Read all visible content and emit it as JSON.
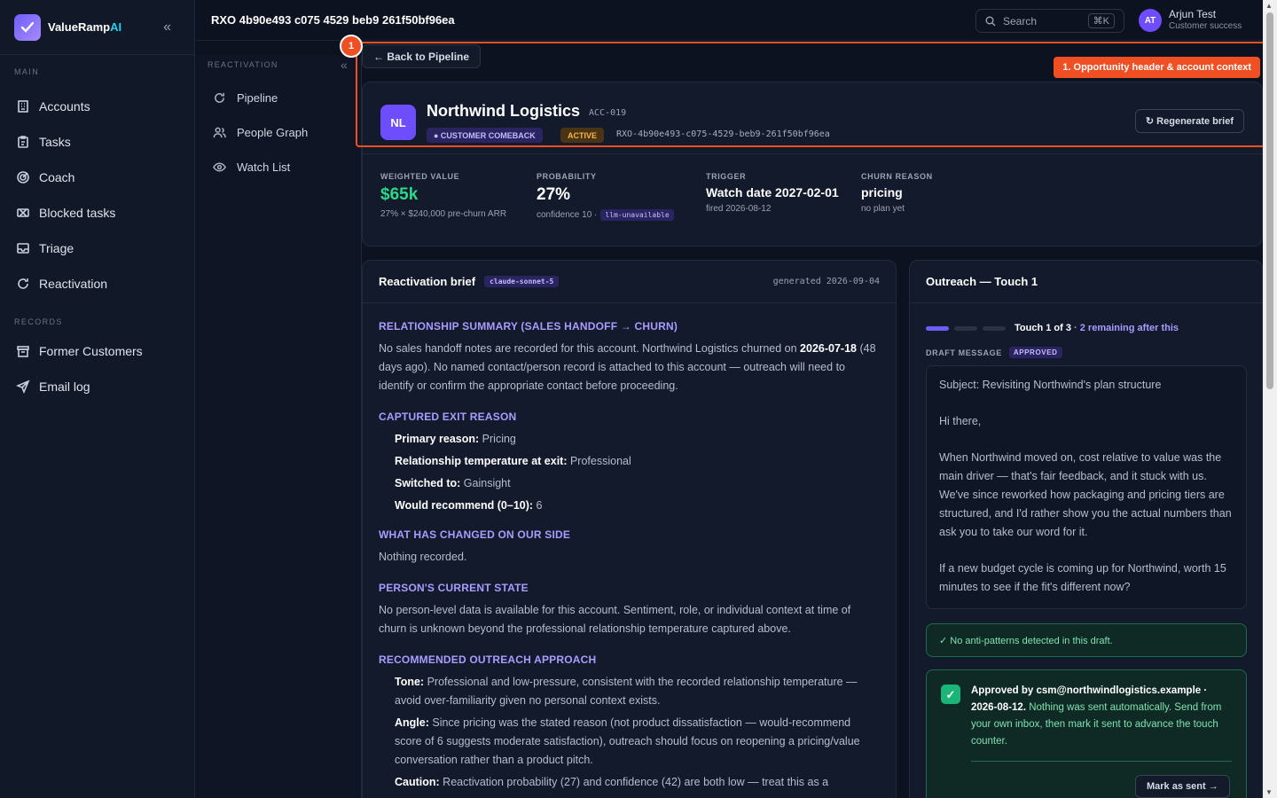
{
  "brand": {
    "name": "ValueRamp",
    "ai": "AI"
  },
  "sidebar": {
    "main_label": "MAIN",
    "records_label": "RECORDS",
    "main": [
      {
        "label": "Accounts",
        "icon": "building-icon"
      },
      {
        "label": "Tasks",
        "icon": "clipboard-icon"
      },
      {
        "label": "Coach",
        "icon": "target-icon"
      },
      {
        "label": "Blocked tasks",
        "icon": "blocked-icon"
      },
      {
        "label": "Triage",
        "icon": "inbox-icon"
      },
      {
        "label": "Reactivation",
        "icon": "refresh-icon"
      }
    ],
    "records": [
      {
        "label": "Former Customers",
        "icon": "archive-icon"
      },
      {
        "label": "Email log",
        "icon": "send-icon"
      }
    ]
  },
  "subnav": {
    "title": "REACTIVATION",
    "items": [
      {
        "label": "Pipeline",
        "icon": "refresh-icon"
      },
      {
        "label": "People Graph",
        "icon": "people-icon"
      },
      {
        "label": "Watch List",
        "icon": "eye-icon"
      }
    ]
  },
  "topbar": {
    "title": "RXO 4b90e493 c075 4529 beb9 261f50bf96ea",
    "search": "Search",
    "shortcut": "⌘K",
    "user_initials": "AT",
    "user_name": "Arjun Test",
    "user_role": "Customer success"
  },
  "annotation": {
    "number": "1",
    "label": "1. Opportunity header & account context"
  },
  "back": "← Back to Pipeline",
  "account": {
    "initials": "NL",
    "name": "Northwind Logistics",
    "id": "ACC-019",
    "tag1": "● CUSTOMER COMEBACK",
    "tag2": "ACTIVE",
    "rxo": "RXO-4b90e493-c075-4529-beb9-261f50bf96ea",
    "regen": "↻ Regenerate brief"
  },
  "metrics": {
    "weighted": {
      "label": "WEIGHTED VALUE",
      "value": "$65k",
      "sub": "27% × $240,000 pre-churn ARR"
    },
    "probability": {
      "label": "PROBABILITY",
      "value": "27%",
      "sub": "confidence 10 ·",
      "tag": "llm-unavailable"
    },
    "trigger": {
      "label": "TRIGGER",
      "value": "Watch date 2027-02-01",
      "sub": "fired 2026-08-12"
    },
    "churn": {
      "label": "CHURN REASON",
      "value": "pricing",
      "sub": "no plan yet"
    }
  },
  "brief": {
    "title": "Reactivation brief",
    "model": "claude-sonnet-5",
    "generated": "generated 2026-09-04",
    "h1": "RELATIONSHIP SUMMARY (SALES HANDOFF → CHURN)",
    "p1a": "No sales handoff notes are recorded for this account. Northwind Logistics churned on ",
    "p1b": "2026-07-18",
    "p1c": " (48 days ago). No named contact/person record is attached to this account — outreach will need to identify or confirm the appropriate contact before proceeding.",
    "h2": "CAPTURED EXIT REASON",
    "exit": [
      {
        "k": "Primary reason:",
        "v": " Pricing"
      },
      {
        "k": "Relationship temperature at exit:",
        "v": " Professional"
      },
      {
        "k": "Switched to:",
        "v": " Gainsight"
      },
      {
        "k": "Would recommend (0–10):",
        "v": " 6"
      }
    ],
    "h3": "WHAT HAS CHANGED ON OUR SIDE",
    "p3": "Nothing recorded.",
    "h4": "PERSON'S CURRENT STATE",
    "p4": "No person-level data is available for this account. Sentiment, role, or individual context at time of churn is unknown beyond the professional relationship temperature captured above.",
    "h5": "RECOMMENDED OUTREACH APPROACH",
    "rec": [
      {
        "k": "Tone:",
        "v": " Professional and low-pressure, consistent with the recorded relationship temperature — avoid over-familiarity given no personal context exists."
      },
      {
        "k": "Angle:",
        "v": " Since pricing was the stated reason (not product dissatisfaction — would-recommend score of 6 suggests moderate satisfaction), outreach should focus on reopening a pricing/value conversation rather than a product pitch."
      },
      {
        "k": "Caution:",
        "v": " Reactivation probability (27) and confidence (42) are both low — treat this as a"
      }
    ]
  },
  "outreach": {
    "title": "Outreach — Touch 1",
    "touch": "Touch 1 of 3",
    "remaining": " · 2 remaining after this",
    "draft_label": "DRAFT MESSAGE",
    "draft_status": "APPROVED",
    "draft": [
      "Subject: Revisiting Northwind's plan structure",
      "Hi there,",
      "When Northwind moved on, cost relative to value was the main driver — that's fair feedback, and it stuck with us. We've since reworked how packaging and pricing tiers are structured, and I'd rather show you the actual numbers than ask you to take our word for it.",
      "If a new budget cycle is coming up for Northwind, worth 15 minutes to see if the fit's different now?"
    ],
    "anti": "✓  No anti-patterns detected in this draft.",
    "approved_a": "Approved by csm@northwindlogistics.example · 2026-08-12.",
    "approved_b": " Nothing was sent automatically. Send from your own inbox, then mark it sent to advance the touch counter.",
    "mark": "Mark as sent →"
  },
  "colors": {
    "accent": "#6d5dfc",
    "highlight": "#f04e23",
    "success": "#2bd98b"
  }
}
